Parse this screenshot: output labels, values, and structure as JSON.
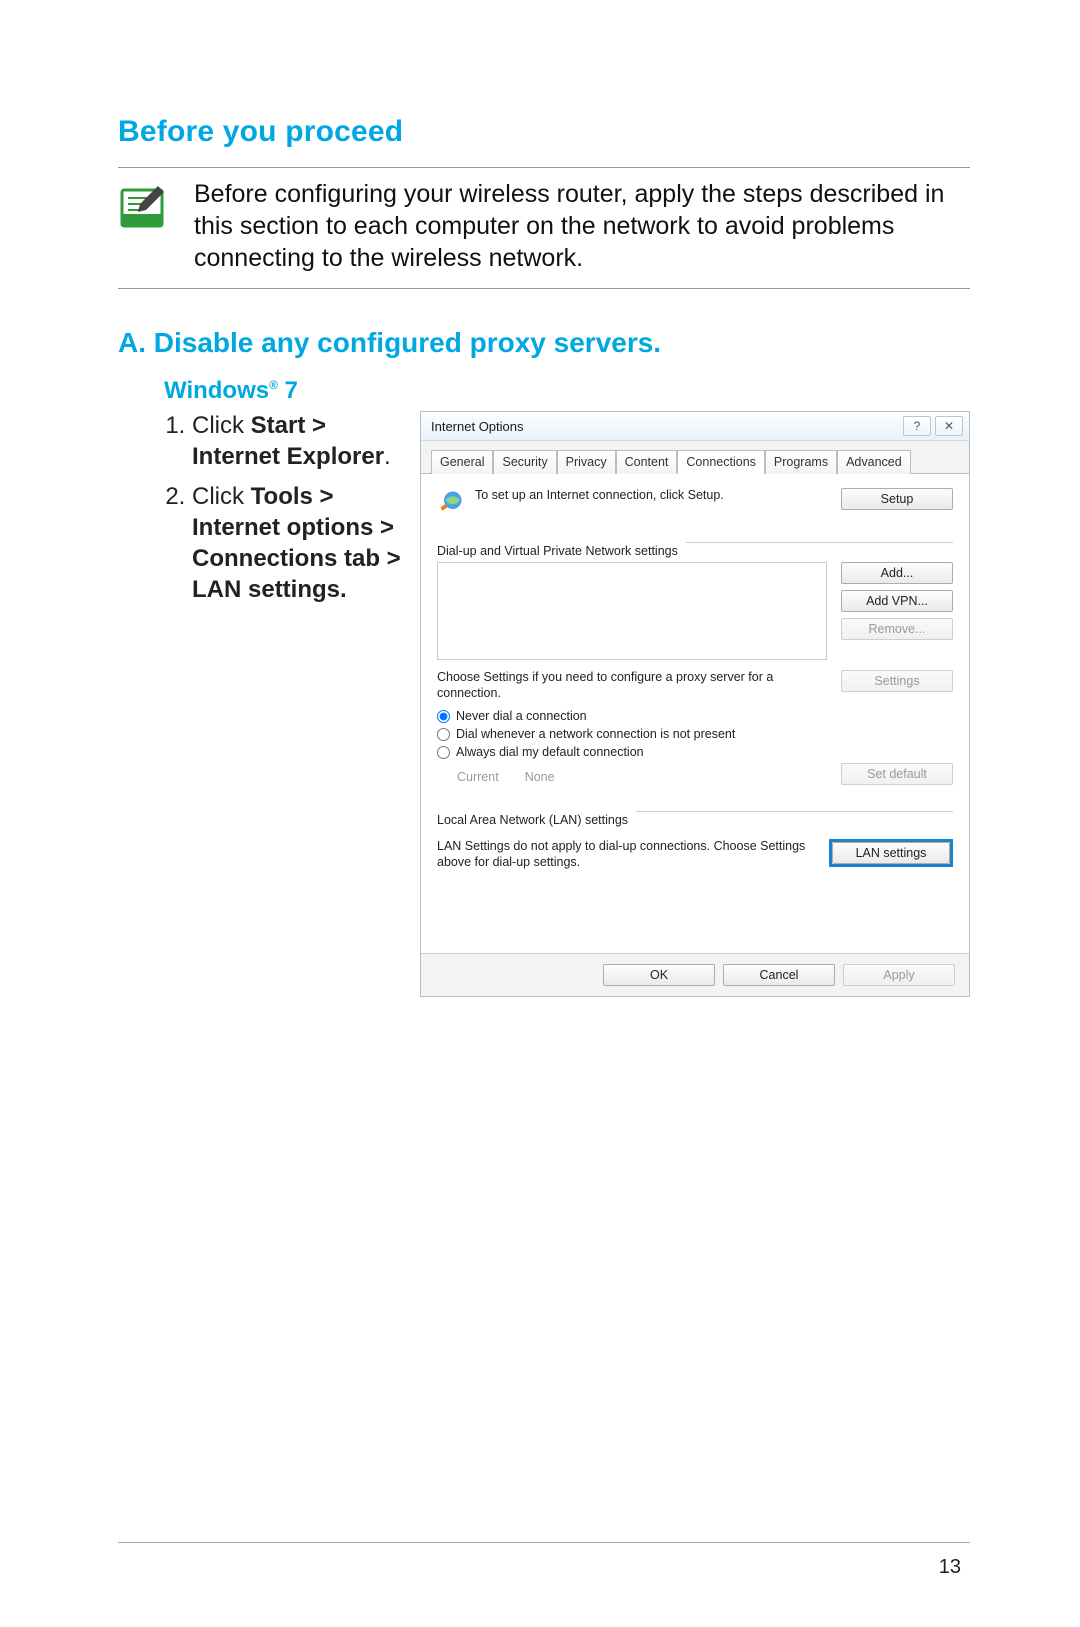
{
  "headings": {
    "before": "Before you proceed",
    "sectionA": "A.   Disable any configured proxy servers.",
    "os": "Windows",
    "osSuffix": " 7"
  },
  "note": "Before configuring your wireless router, apply the steps described in this section to each computer on the network to avoid problems connecting to the wireless network.",
  "steps": {
    "s1_pre": "Click ",
    "s1_bold": "Start > Internet Explorer",
    "s1_post": ".",
    "s2_pre": "Click ",
    "s2_bold": "Tools > Internet options > Connections tab > LAN settings."
  },
  "dialog": {
    "title": "Internet Options",
    "tabs": [
      "General",
      "Security",
      "Privacy",
      "Content",
      "Connections",
      "Programs",
      "Advanced"
    ],
    "setupText": "To set up an Internet connection, click Setup.",
    "btnSetup": "Setup",
    "grpDial": "Dial-up and Virtual Private Network settings",
    "btnAdd": "Add...",
    "btnAddVpn": "Add VPN...",
    "btnRemove": "Remove...",
    "proxyHelp": "Choose Settings if you need to configure a proxy server for a connection.",
    "btnSettings": "Settings",
    "radioNever": "Never dial a connection",
    "radioWhenever": "Dial whenever a network connection is not present",
    "radioAlways": "Always dial my default connection",
    "currentLabel": "Current",
    "currentValue": "None",
    "btnSetDefault": "Set default",
    "grpLan": "Local Area Network (LAN) settings",
    "lanHelp": "LAN Settings do not apply to dial-up connections. Choose Settings above for dial-up settings.",
    "btnLan": "LAN settings",
    "btnOk": "OK",
    "btnCancel": "Cancel",
    "btnApply": "Apply"
  },
  "pageNumber": "13"
}
